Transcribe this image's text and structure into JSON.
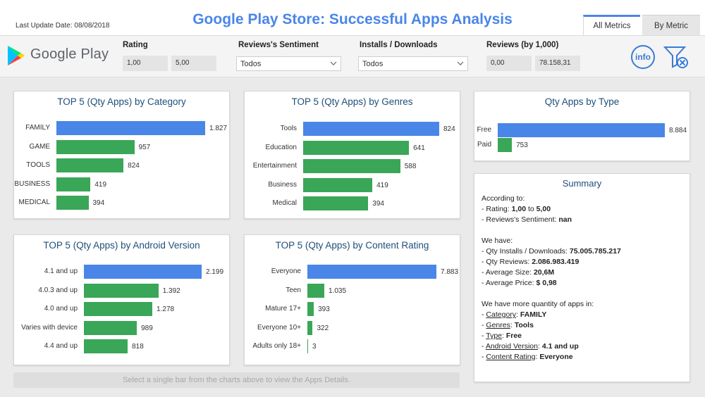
{
  "header": {
    "update_label": "Last Update Date: 08/08/2018",
    "title": "Google Play Store: Successful Apps Analysis",
    "tabs": [
      {
        "label": "All Metrics",
        "active": true
      },
      {
        "label": "By Metric",
        "active": false
      }
    ]
  },
  "logo": {
    "text": "Google Play"
  },
  "filters": {
    "rating": {
      "label": "Rating",
      "min": "1,00",
      "max": "5,00"
    },
    "sentiment": {
      "label": "Reviews's Sentiment",
      "value": "Todos"
    },
    "installs": {
      "label": "Installs / Downloads",
      "value": "Todos"
    },
    "reviews": {
      "label": "Reviews (by 1,000)",
      "min": "0,00",
      "max": "78.158,31"
    }
  },
  "buttons": {
    "info": "info"
  },
  "colors": {
    "highlight": "#4a86e8",
    "bar": "#3aa657",
    "title": "#1f4e79"
  },
  "charts": {
    "category": {
      "title": "TOP 5 (Qty Apps) by Category",
      "rows": [
        {
          "label": "FAMILY",
          "value": 1827,
          "text": "1.827"
        },
        {
          "label": "GAME",
          "value": 957,
          "text": "957"
        },
        {
          "label": "TOOLS",
          "value": 824,
          "text": "824"
        },
        {
          "label": "BUSINESS",
          "value": 419,
          "text": "419"
        },
        {
          "label": "MEDICAL",
          "value": 394,
          "text": "394"
        }
      ]
    },
    "genres": {
      "title": "TOP 5 (Qty Apps) by Genres",
      "rows": [
        {
          "label": "Tools",
          "value": 824,
          "text": "824"
        },
        {
          "label": "Education",
          "value": 641,
          "text": "641"
        },
        {
          "label": "Entertainment",
          "value": 588,
          "text": "588"
        },
        {
          "label": "Business",
          "value": 419,
          "text": "419"
        },
        {
          "label": "Medical",
          "value": 394,
          "text": "394"
        }
      ]
    },
    "type": {
      "title": "Qty Apps by Type",
      "rows": [
        {
          "label": "Free",
          "value": 8884,
          "text": "8.884"
        },
        {
          "label": "Paid",
          "value": 753,
          "text": "753"
        }
      ]
    },
    "android": {
      "title": "TOP 5 (Qty Apps) by Android Version",
      "rows": [
        {
          "label": "4.1 and up",
          "value": 2199,
          "text": "2.199"
        },
        {
          "label": "4.0.3 and up",
          "value": 1392,
          "text": "1.392"
        },
        {
          "label": "4.0 and up",
          "value": 1278,
          "text": "1.278"
        },
        {
          "label": "Varies with device",
          "value": 989,
          "text": "989"
        },
        {
          "label": "4.4 and up",
          "value": 818,
          "text": "818"
        }
      ]
    },
    "content": {
      "title": "TOP 5 (Qty Apps) by Content Rating",
      "rows": [
        {
          "label": "Everyone",
          "value": 7883,
          "text": "7.883"
        },
        {
          "label": "Teen",
          "value": 1035,
          "text": "1.035"
        },
        {
          "label": "Mature 17+",
          "value": 393,
          "text": "393"
        },
        {
          "label": "Everyone 10+",
          "value": 322,
          "text": "322"
        },
        {
          "label": "Adults only 18+",
          "value": 3,
          "text": "3"
        }
      ]
    }
  },
  "chart_data": [
    {
      "type": "bar",
      "title": "TOP 5 (Qty Apps) by Category",
      "categories": [
        "FAMILY",
        "GAME",
        "TOOLS",
        "BUSINESS",
        "MEDICAL"
      ],
      "values": [
        1827,
        957,
        824,
        419,
        394
      ]
    },
    {
      "type": "bar",
      "title": "TOP 5 (Qty Apps) by Genres",
      "categories": [
        "Tools",
        "Education",
        "Entertainment",
        "Business",
        "Medical"
      ],
      "values": [
        824,
        641,
        588,
        419,
        394
      ]
    },
    {
      "type": "bar",
      "title": "Qty Apps by Type",
      "categories": [
        "Free",
        "Paid"
      ],
      "values": [
        8884,
        753
      ]
    },
    {
      "type": "bar",
      "title": "TOP 5 (Qty Apps) by Android Version",
      "categories": [
        "4.1 and up",
        "4.0.3 and up",
        "4.0 and up",
        "Varies with device",
        "4.4 and up"
      ],
      "values": [
        2199,
        1392,
        1278,
        989,
        818
      ]
    },
    {
      "type": "bar",
      "title": "TOP 5 (Qty Apps) by Content Rating",
      "categories": [
        "Everyone",
        "Teen",
        "Mature 17+",
        "Everyone 10+",
        "Adults only 18+"
      ],
      "values": [
        7883,
        1035,
        393,
        322,
        3
      ]
    }
  ],
  "summary": {
    "title": "Summary",
    "according": "According to:",
    "rating_pre": "- Rating: ",
    "rating_min": "1,00",
    "rating_to": " to ",
    "rating_max": "5,00",
    "sentiment_pre": "- Reviews's Sentiment: ",
    "sentiment_val": "nan",
    "we_have": "We have:",
    "installs_pre": "- Qty Installs / Downloads: ",
    "installs_val": "75.005.785.217",
    "reviews_pre": "- Qty Reviews: ",
    "reviews_val": "2.086.983.419",
    "size_pre": "- Average Size: ",
    "size_val": "20,6M",
    "price_pre": "- Average Price: ",
    "price_val": "$ 0,98",
    "more_qty": "We have more quantity of apps in:",
    "cat_key": "Category",
    "cat_val": "FAMILY",
    "gen_key": "Genres",
    "gen_val": "Tools",
    "type_key": "Type",
    "type_val": "Free",
    "and_key": "Android Version",
    "and_val": "4.1 and up",
    "cont_key": "Content Rating",
    "cont_val": "Everyone"
  },
  "hint": "Select a single bar from the charts above to view the Apps Details."
}
